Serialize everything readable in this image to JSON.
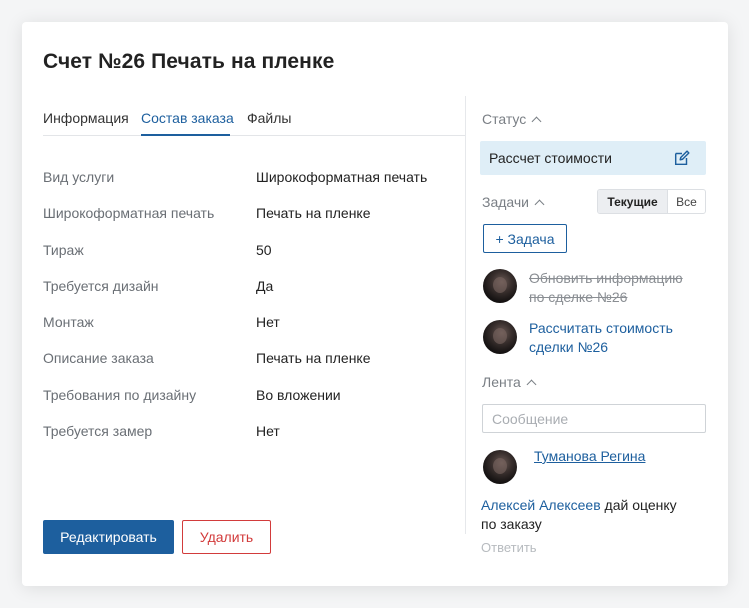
{
  "invoice": {
    "title": "Счет №26 Печать на пленке"
  },
  "tabs": [
    {
      "label": "Информация",
      "active": false
    },
    {
      "label": "Состав заказа",
      "active": true
    },
    {
      "label": "Файлы",
      "active": false
    }
  ],
  "fields": [
    {
      "label": "Вид услуги",
      "value": "Широкоформатная печать"
    },
    {
      "label": "Широкоформатная печать",
      "value": "Печать на пленке"
    },
    {
      "label": "Тираж",
      "value": "50"
    },
    {
      "label": "Требуется дизайн",
      "value": "Да"
    },
    {
      "label": "Монтаж",
      "value": "Нет"
    },
    {
      "label": "Описание заказа",
      "value": "Печать на пленке"
    },
    {
      "label": "Требования по дизайну",
      "value": "Во вложении"
    },
    {
      "label": "Требуется замер",
      "value": "Нет"
    }
  ],
  "actions": {
    "edit_label": "Редактировать",
    "delete_label": "Удалить"
  },
  "status": {
    "title": "Статус",
    "value": "Рассчет стоимости"
  },
  "tasks": {
    "title": "Задачи",
    "filter_current": "Текущие",
    "filter_all": "Все",
    "add_label": "+ Задача",
    "items": [
      {
        "text_line1": "Обновить информацию",
        "text_line2": "по сделке №26",
        "done": true
      },
      {
        "text_line1": "Рассчитать стоимость",
        "text_line2": "сделки №26",
        "done": false
      }
    ]
  },
  "feed": {
    "title": "Лента",
    "message_placeholder": "Сообщение",
    "user": "Туманова Регина",
    "entry_author": "Алексей Алексеев",
    "entry_text_1": " дай оценку",
    "entry_text_2": "по заказу",
    "reply_label": "Ответить"
  },
  "colors": {
    "accent": "#1d5f9e",
    "danger": "#d23b3b",
    "status_bg": "#dfeef7"
  }
}
